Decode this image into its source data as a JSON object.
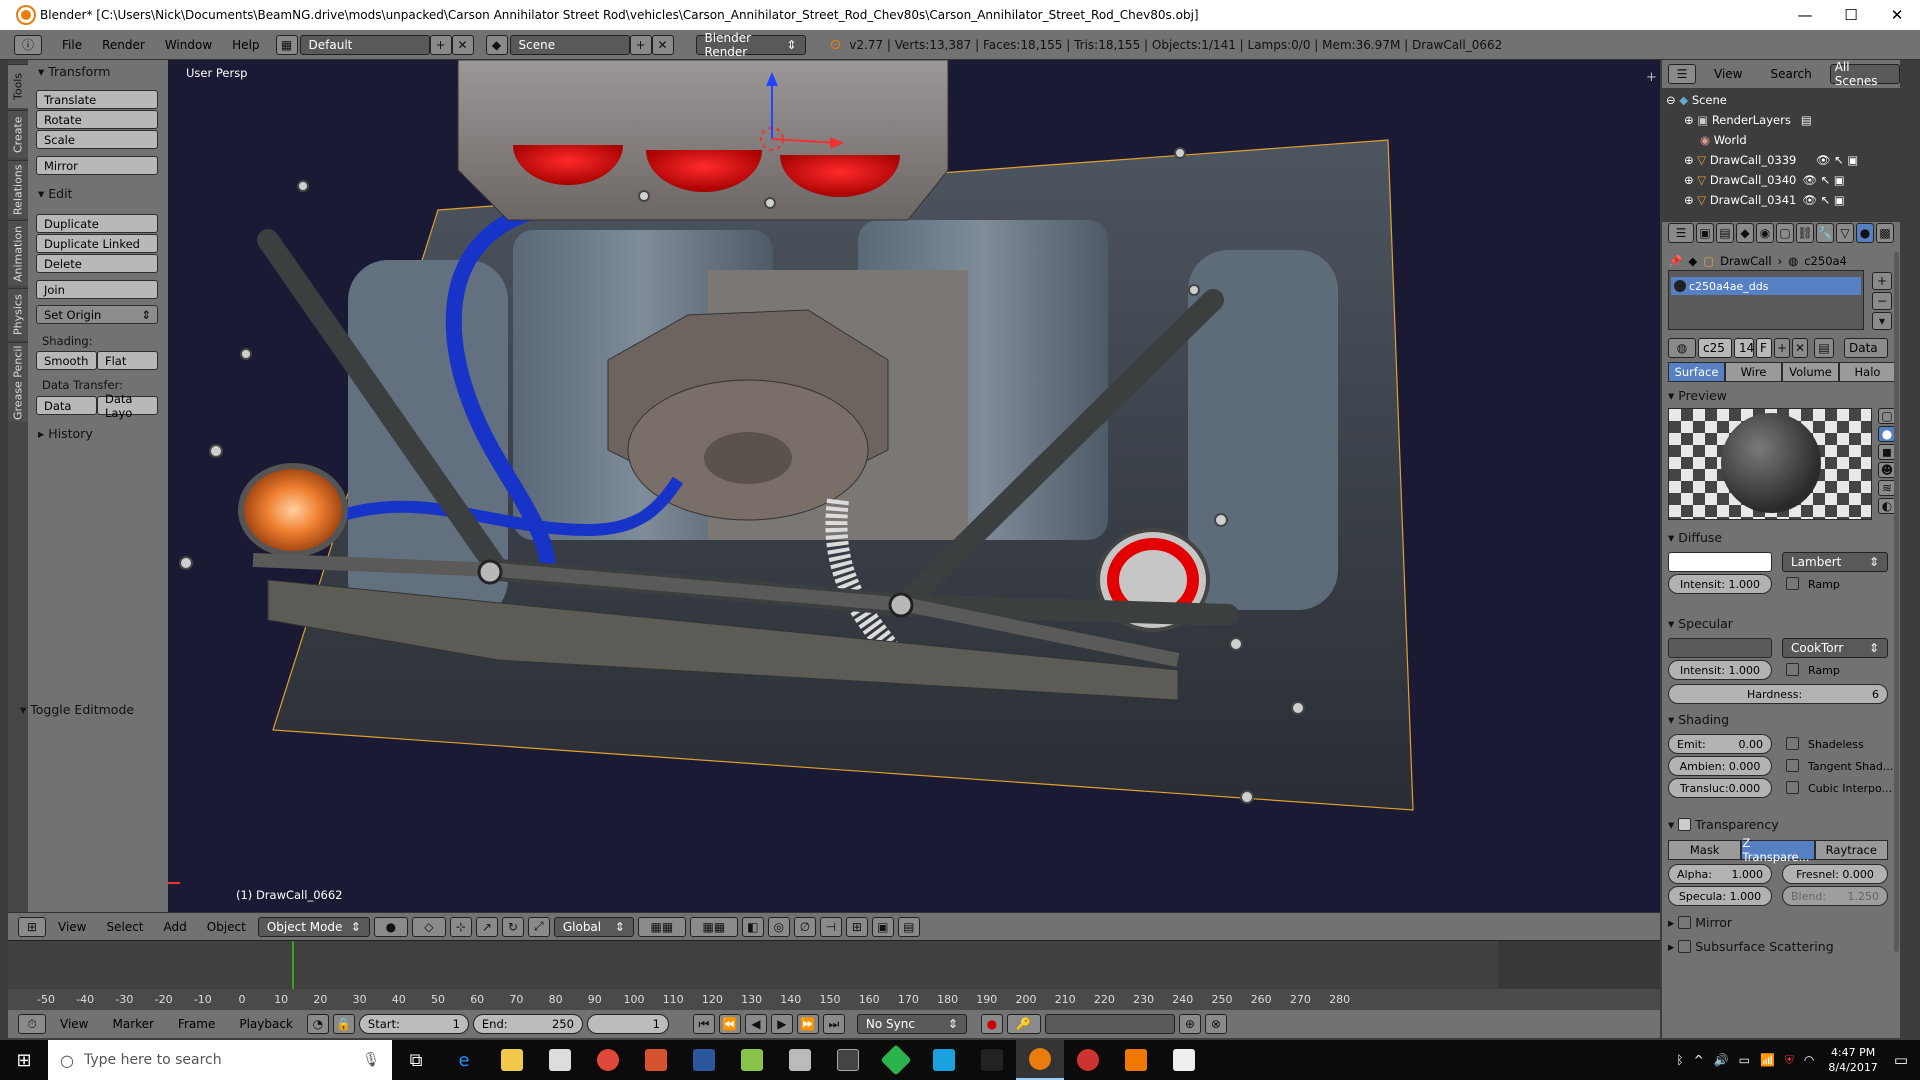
{
  "window": {
    "title": "Blender* [C:\\Users\\Nick\\Documents\\BeamNG.drive\\mods\\unpacked\\Carson Annihilator Street Rod\\vehicles\\Carson_Annihilator_Street_Rod_Chev80s\\Carson_Annihilator_Street_Rod_Chev80s.obj]",
    "minimize": "—",
    "maximize": "☐",
    "close": "✕"
  },
  "header": {
    "menus": [
      "File",
      "Render",
      "Window",
      "Help"
    ],
    "layout": "Default",
    "scene": "Scene",
    "engine": "Blender Render",
    "stats": "v2.77 | Verts:13,387 | Faces:18,155 | Tris:18,155 | Objects:1/141 | Lamps:0/0 | Mem:36.97M | DrawCall_0662"
  },
  "vtabs": [
    "Tools",
    "Create",
    "Relations",
    "Animation",
    "Physics",
    "Grease Pencil"
  ],
  "toolshelf": {
    "transform_header": "Transform",
    "translate": "Translate",
    "rotate": "Rotate",
    "scale": "Scale",
    "mirror": "Mirror",
    "edit_header": "Edit",
    "duplicate": "Duplicate",
    "duplicate_linked": "Duplicate Linked",
    "delete": "Delete",
    "join": "Join",
    "set_origin": "Set Origin",
    "shading_label": "Shading:",
    "smooth": "Smooth",
    "flat": "Flat",
    "data_transfer_label": "Data Transfer:",
    "data": "Data",
    "data_layout": "Data Layo",
    "history_header": "History",
    "toggle_editmode": "Toggle Editmode"
  },
  "viewport": {
    "view_label": "User Persp",
    "object_label": "(1) DrawCall_0662"
  },
  "viewport_header": {
    "menus": [
      "View",
      "Select",
      "Add",
      "Object"
    ],
    "mode": "Object Mode",
    "orientation": "Global"
  },
  "timeline": {
    "ticks": [
      "-50",
      "-40",
      "-30",
      "-20",
      "-10",
      "0",
      "10",
      "20",
      "30",
      "40",
      "50",
      "60",
      "70",
      "80",
      "90",
      "100",
      "110",
      "120",
      "130",
      "140",
      "150",
      "160",
      "170",
      "180",
      "190",
      "200",
      "210",
      "220",
      "230",
      "240",
      "250",
      "260",
      "270",
      "280"
    ],
    "current_frame_marker": 0
  },
  "timeline_header": {
    "menus": [
      "View",
      "Marker",
      "Frame",
      "Playback"
    ],
    "start_label": "Start:",
    "start": "1",
    "end_label": "End:",
    "end": "250",
    "current": "1",
    "sync": "No Sync"
  },
  "outliner": {
    "view": "View",
    "search": "Search",
    "filter": "All Scenes",
    "rows": [
      "Scene",
      "RenderLayers",
      "World",
      "DrawCall_0339",
      "DrawCall_0340",
      "DrawCall_0341"
    ]
  },
  "properties": {
    "breadcrumb_obj": "DrawCall",
    "breadcrumb_mat": "c250a4",
    "material_slot": "c250a4ae_dds",
    "mat_name_short": "c25",
    "mat_users": "14",
    "mat_fake": "F",
    "data_dropdown": "Data",
    "tabs": [
      "Surface",
      "Wire",
      "Volume",
      "Halo"
    ],
    "preview_header": "Preview",
    "diffuse_header": "Diffuse",
    "diffuse_shader": "Lambert",
    "diffuse_intensity": "Intensit: 1.000",
    "ramp": "Ramp",
    "specular_header": "Specular",
    "specular_shader": "CookTorr",
    "specular_intensity": "Intensit: 1.000",
    "hardness_label": "Hardness:",
    "hardness": "6",
    "shading_header": "Shading",
    "emit": "Emit:",
    "emit_value": "0.00",
    "ambient": "Ambien: 0.000",
    "translucency": "Transluc:0.000",
    "shadeless": "Shadeless",
    "tangent": "Tangent Shad...",
    "cubic": "Cubic Interpo...",
    "transparency_header": "Transparency",
    "transp_tabs": [
      "Mask",
      "Z Transpare...",
      "Raytrace"
    ],
    "alpha": "Alpha:",
    "alpha_value": "1.000",
    "fresnel": "Fresnel: 0.000",
    "specular_t": "Specula: 1.000",
    "blend": "Blend:",
    "blend_value": "1.250",
    "mirror_header": "Mirror",
    "sss_header": "Subsurface Scattering"
  },
  "taskbar": {
    "search_placeholder": "Type here to search",
    "time": "4:47 PM",
    "date": "8/4/2017"
  }
}
